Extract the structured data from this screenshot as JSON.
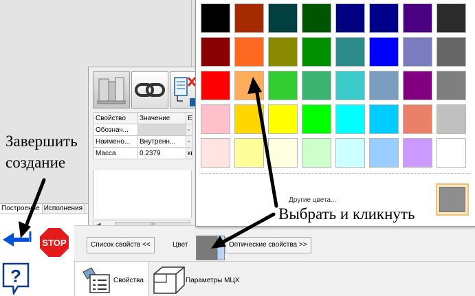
{
  "mode_tabs": [
    "Построение",
    "Исполнения"
  ],
  "props_table": {
    "headers": [
      "Свойство",
      "Значение",
      "Ед"
    ],
    "rows": [
      {
        "prop": "Обознач...",
        "value": "",
        "unit": "-"
      },
      {
        "prop": "Наимено...",
        "value": "Внутренн...",
        "unit": "-"
      },
      {
        "prop": "Масса",
        "value": "0.2379",
        "unit": "кг"
      }
    ]
  },
  "scrollbar_grip": "III",
  "annotations": {
    "finish": [
      "Завершить",
      "создание"
    ],
    "choose": "Выбрать и кликнуть"
  },
  "bottom_bar": {
    "props_list_button": "Список свойств  <<",
    "color_label": "Цвет",
    "color_value": "#7a7a7a",
    "optical_button": "Оптические свойства  >>"
  },
  "stop_label": "STOP",
  "help_label": "?",
  "bottom_tabs": {
    "properties": "Свойства",
    "mass_params": "Параметры МЦХ"
  },
  "palette": {
    "rows": [
      [
        "#000000",
        "#a52a00",
        "#004040",
        "#005500",
        "#000080",
        "#00008b",
        "#4b0082",
        "#2b2b2b"
      ],
      [
        "#8b0000",
        "#ff6820",
        "#8b8b00",
        "#009000",
        "#2e8b8b",
        "#0000ff",
        "#7b7bc0",
        "#666666"
      ],
      [
        "#ff0000",
        "#ffad5b",
        "#32cd32",
        "#3cb371",
        "#3ccbcb",
        "#7b9ec0",
        "#800080",
        "#7f7f7f"
      ],
      [
        "#ffc0cb",
        "#ffd700",
        "#ffff00",
        "#00ff00",
        "#00ffff",
        "#00ccff",
        "#ea8068",
        "#c0c0c0"
      ],
      [
        "#ffe4e1",
        "#ffff99",
        "#ffffe0",
        "#ccffcc",
        "#ccffff",
        "#99ccff",
        "#cc99ff",
        "#ffffff"
      ]
    ],
    "more_colors_label": "Другие цвета...",
    "more_color_value": "#8e8e8e"
  }
}
